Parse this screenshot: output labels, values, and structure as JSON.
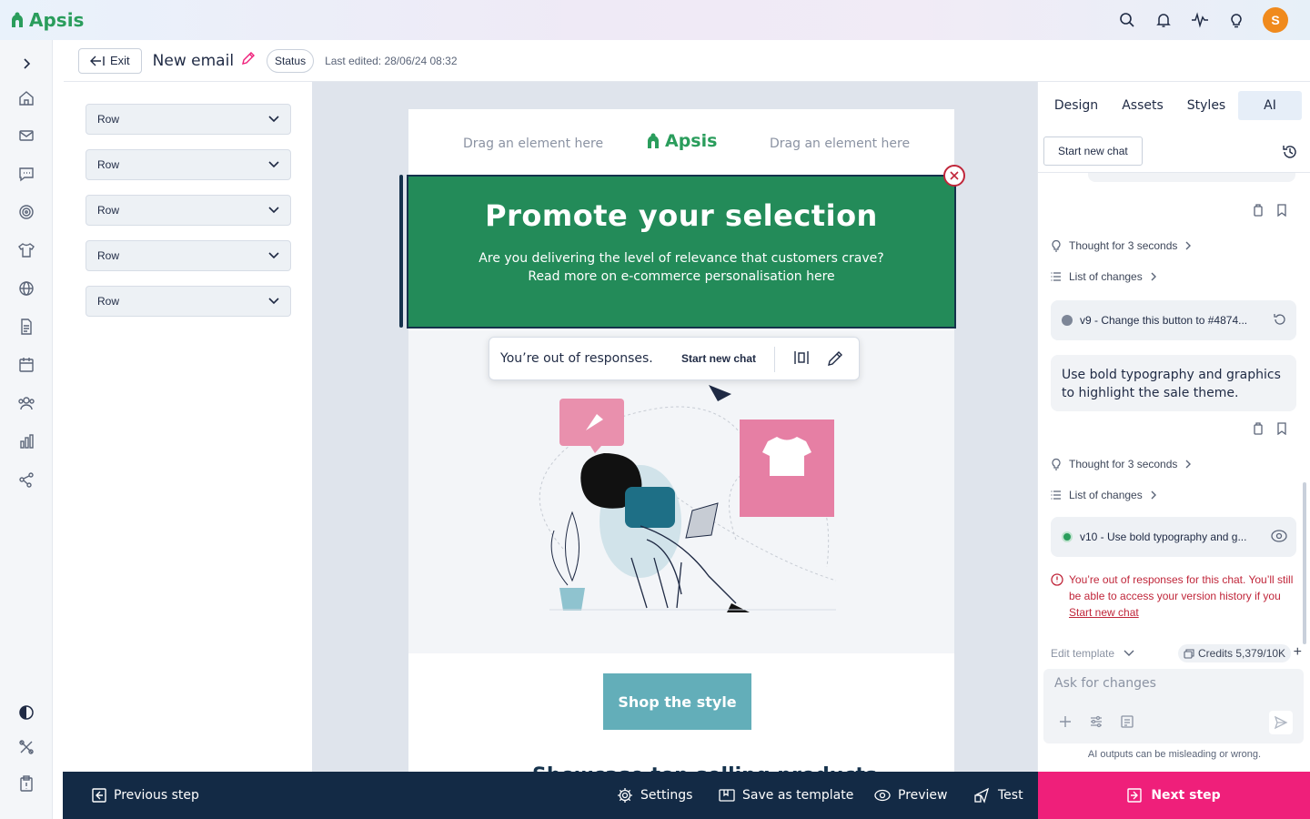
{
  "app": {
    "name": "Apsis",
    "avatar_initial": "S",
    "brand_color": "#2a9d5c",
    "accent_color": "#ef1f7a"
  },
  "topbar": {
    "icons": [
      "search-icon",
      "bell-icon",
      "activity-icon",
      "lightbulb-icon"
    ]
  },
  "rail": {
    "icons": [
      "chevron-right-icon",
      "home-icon",
      "mail-icon",
      "chat-icon",
      "target-icon",
      "shirt-icon",
      "globe-icon",
      "document-icon",
      "calendar-icon",
      "users-icon",
      "bar-chart-icon",
      "share-icon",
      "contrast-icon",
      "tools-icon",
      "clipboard-icon"
    ]
  },
  "header": {
    "exit_label": "Exit",
    "title": "New email",
    "status_label": "Status",
    "last_edited": "Last edited: 28/06/24 08:32"
  },
  "rows": [
    {
      "label": "Row"
    },
    {
      "label": "Row"
    },
    {
      "label": "Row"
    },
    {
      "label": "Row"
    },
    {
      "label": "Row"
    }
  ],
  "email": {
    "drag_left": "Drag an element here",
    "drag_right": "Drag an element here",
    "logo_text": "Apsis",
    "promo_title": "Promote your selection",
    "promo_line1": "Are you delivering the level of relevance that customers crave?",
    "promo_line2": "Read more on e-commerce personalisation here",
    "promo_color": "#238b59",
    "shop_button": "Shop the style",
    "next_heading": "Showcase top selling products"
  },
  "popup": {
    "message": "You’re out of responses.",
    "link": "Start new chat"
  },
  "right_panel": {
    "tabs": [
      "Design",
      "Assets",
      "Styles",
      "AI"
    ],
    "active_tab": "AI",
    "start_new_chat": "Start new chat",
    "thought_1": "Thought for 3 seconds",
    "changes_1": "List of changes",
    "version_1": "v9 - Change this button to #4874...",
    "message": "Use bold typography and graphics to highlight the sale theme.",
    "thought_2": "Thought for 3 seconds",
    "changes_2": "List of changes",
    "version_2": "v10 - Use bold typography and g...",
    "error_text": "You’re out of responses for this chat. You’ll still be able to access your version history if you",
    "error_link": "Start new chat",
    "edit_template": "Edit template",
    "credits": "Credits 5,379/10K",
    "composer_placeholder": "Ask for changes",
    "disclaimer": "AI outputs can be misleading or wrong."
  },
  "footer": {
    "previous": "Previous step",
    "settings": "Settings",
    "save_template": "Save as template",
    "preview": "Preview",
    "test": "Test",
    "next": "Next step"
  }
}
